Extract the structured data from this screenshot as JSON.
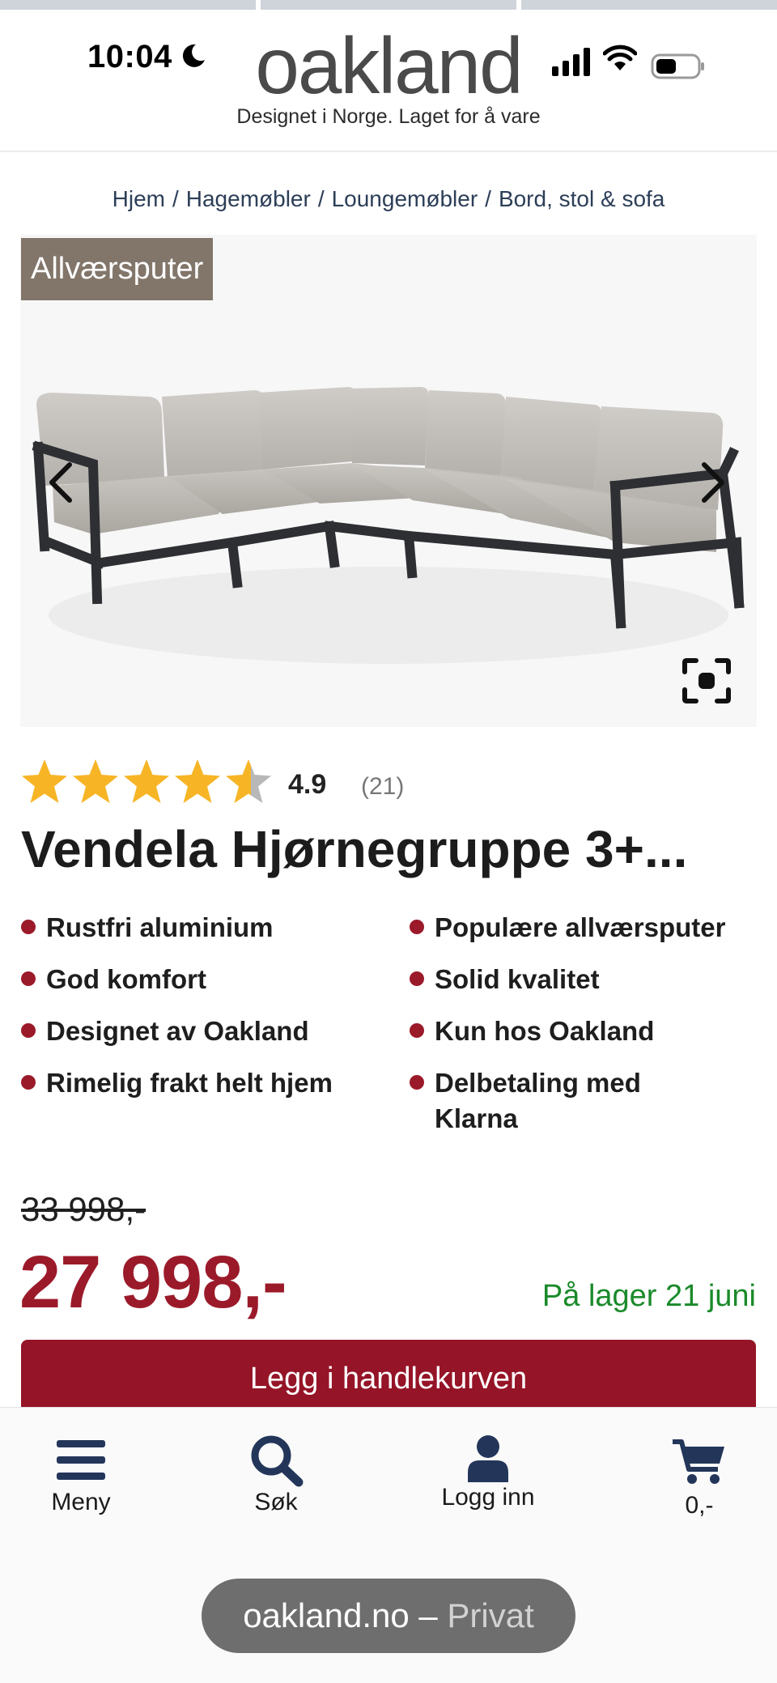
{
  "status_bar": {
    "time": "10:04"
  },
  "header": {
    "logo": "oakland",
    "tagline": "Designet i Norge. Laget for å vare"
  },
  "breadcrumb": [
    "Hjem",
    "Hagemøbler",
    "Loungemøbler",
    "Bord, stol & sofa"
  ],
  "product": {
    "badge": "Allværsputer",
    "rating": {
      "value": "4.9",
      "count": "(21)",
      "stars": 4.9,
      "max_stars": 5
    },
    "title": "Vendela Hjørnegruppe 3+...",
    "features": [
      "Rustfri aluminium",
      "Populære allværsputer",
      "God komfort",
      "Solid kvalitet",
      "Designet av Oakland",
      "Kun hos Oakland",
      "Rimelig frakt helt hjem",
      "Delbetaling med Klarna"
    ],
    "old_price": "33 998,-",
    "price": "27 998,-",
    "stock": "På lager 21 juni",
    "add_to_cart": "Legg i handlekurven"
  },
  "bottom_nav": {
    "menu": "Meny",
    "search": "Søk",
    "login": "Logg inn",
    "cart": "0,-"
  },
  "browser": {
    "domain": "oakland.no",
    "dash": " – ",
    "mode": "Privat"
  },
  "colors": {
    "accent_red": "#9b1a2a",
    "button_red": "#951427",
    "badge_brown": "#82766a",
    "stock_green": "#1a8a2a",
    "nav_blue": "#23365a",
    "star_gold": "#f7b526"
  }
}
